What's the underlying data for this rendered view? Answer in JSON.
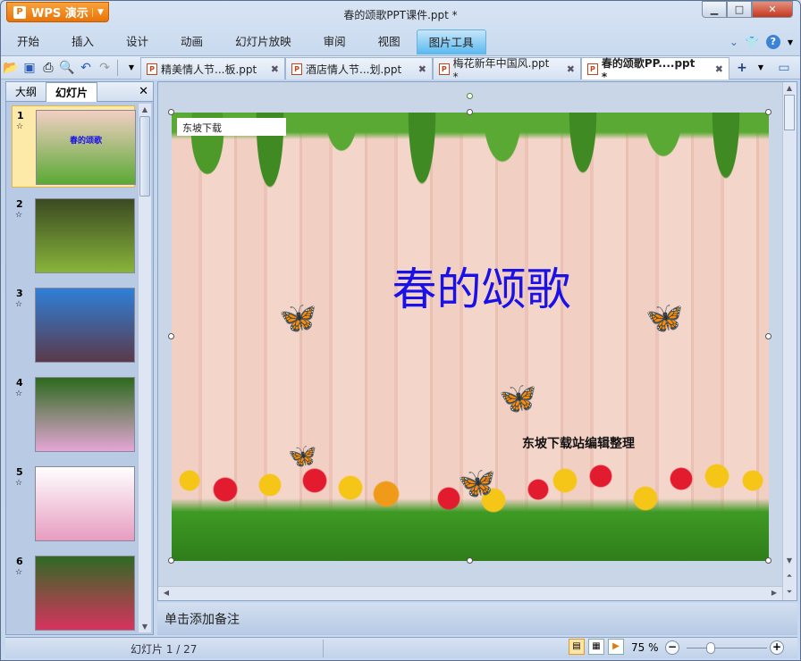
{
  "app": {
    "brand": "WPS 演示",
    "title": "春的颂歌PPT课件.ppt *"
  },
  "ribbon": {
    "tabs": [
      "开始",
      "插入",
      "设计",
      "动画",
      "幻灯片放映",
      "审阅",
      "视图",
      "图片工具"
    ],
    "active": "图片工具"
  },
  "doc_tabs": [
    {
      "label": "精美情人节...板.ppt"
    },
    {
      "label": "酒店情人节...划.ppt"
    },
    {
      "label": "梅花新年中国风.ppt *"
    },
    {
      "label": "春的颂歌PP....ppt *",
      "active": true
    }
  ],
  "left_panel": {
    "tabs": [
      "大纲",
      "幻灯片"
    ],
    "active": "幻灯片",
    "slides": [
      {
        "num": "1",
        "thumb_title": "春的颂歌",
        "colors": [
          "#f2cfc3",
          "#5aa934"
        ]
      },
      {
        "num": "2",
        "colors": [
          "#3b4a22",
          "#88b43a"
        ]
      },
      {
        "num": "3",
        "colors": [
          "#2f7fd8",
          "#5a3a4a"
        ]
      },
      {
        "num": "4",
        "colors": [
          "#2c6a1c",
          "#e4a6d6"
        ]
      },
      {
        "num": "5",
        "colors": [
          "#ffffff",
          "#e79cc0"
        ]
      },
      {
        "num": "6",
        "colors": [
          "#2f6a24",
          "#d8335e"
        ]
      }
    ]
  },
  "slide": {
    "source_label": "东坡下载",
    "title": "春的颂歌",
    "subtitle": "东坡下载站编辑整理"
  },
  "notes": {
    "placeholder": "单击添加备注"
  },
  "status": {
    "slide_indicator": "幻灯片 1 / 27",
    "zoom": "75 %",
    "zoom_fraction": 0.3
  }
}
